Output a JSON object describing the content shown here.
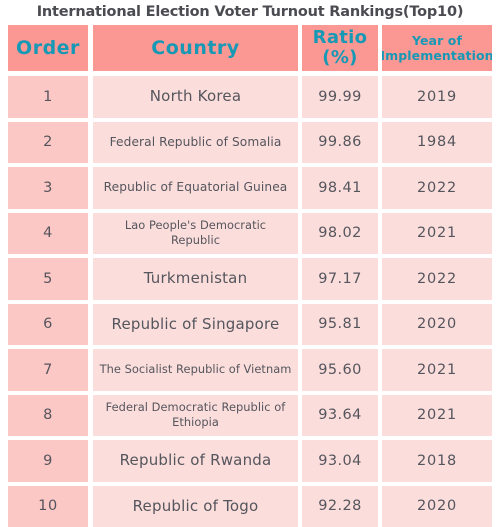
{
  "title": "International Election Voter Turnout Rankings(Top10)",
  "colors": {
    "header_bg": "#FB9894",
    "header_text": "#1799B5",
    "order_cell_bg": "#FCC8C6",
    "cell_bg": "#FBDEDC",
    "body_text": "#55555D",
    "title_text": "#4B4B52",
    "page_bg": "#FFFFFF"
  },
  "columns": [
    {
      "key": "order",
      "label": "Order"
    },
    {
      "key": "country",
      "label": "Country"
    },
    {
      "key": "ratio",
      "label": "Ratio\n(%)",
      "label_line1": "Ratio",
      "label_line2": "(%)"
    },
    {
      "key": "year",
      "label": "Year of Implementation",
      "label_line1": "Year of",
      "label_line2": "Implementation"
    }
  ],
  "rows": [
    {
      "order": "1",
      "country": "North Korea",
      "ratio": "99.99",
      "year": "2019",
      "size": "lg"
    },
    {
      "order": "2",
      "country": "Federal Republic of Somalia",
      "ratio": "99.86",
      "year": "1984",
      "size": "md"
    },
    {
      "order": "3",
      "country": "Republic of Equatorial Guinea",
      "ratio": "98.41",
      "year": "2022",
      "size": "md"
    },
    {
      "order": "4",
      "country": "Lao People's Democratic Republic",
      "ratio": "98.02",
      "year": "2021",
      "size": "sm"
    },
    {
      "order": "5",
      "country": "Turkmenistan",
      "ratio": "97.17",
      "year": "2022",
      "size": "lg"
    },
    {
      "order": "6",
      "country": "Republic of Singapore",
      "ratio": "95.81",
      "year": "2020",
      "size": "lg"
    },
    {
      "order": "7",
      "country": "The Socialist Republic of Vietnam",
      "ratio": "95.60",
      "year": "2021",
      "size": "sm"
    },
    {
      "order": "8",
      "country": "Federal Democratic Republic of Ethiopia",
      "ratio": "93.64",
      "year": "2021",
      "size": "sm"
    },
    {
      "order": "9",
      "country": "Republic of Rwanda",
      "ratio": "93.04",
      "year": "2018",
      "size": "lg"
    },
    {
      "order": "10",
      "country": "Republic of Togo",
      "ratio": "92.28",
      "year": "2020",
      "size": "lg"
    }
  ],
  "chart_data": {
    "type": "table",
    "title": "International Election Voter Turnout Rankings(Top10)",
    "columns": [
      "Order",
      "Country",
      "Ratio (%)",
      "Year of Implementation"
    ],
    "categories": [
      "North Korea",
      "Federal Republic of Somalia",
      "Republic of Equatorial Guinea",
      "Lao People's Democratic Republic",
      "Turkmenistan",
      "Republic of Singapore",
      "The Socialist Republic of Vietnam",
      "Federal Democratic Republic of Ethiopia",
      "Republic of Rwanda",
      "Republic of Togo"
    ],
    "values": [
      99.99,
      99.86,
      98.41,
      98.02,
      97.17,
      95.81,
      95.6,
      93.64,
      93.04,
      92.28
    ],
    "series": [
      {
        "name": "Ratio (%)",
        "values": [
          99.99,
          99.86,
          98.41,
          98.02,
          97.17,
          95.81,
          95.6,
          93.64,
          93.04,
          92.28
        ]
      },
      {
        "name": "Year of Implementation",
        "values": [
          2019,
          1984,
          2022,
          2021,
          2022,
          2020,
          2021,
          2021,
          2018,
          2020
        ]
      },
      {
        "name": "Order",
        "values": [
          1,
          2,
          3,
          4,
          5,
          6,
          7,
          8,
          9,
          10
        ]
      }
    ],
    "xlabel": "Country",
    "ylabel": "Ratio (%)",
    "grid": false,
    "legend": "none"
  }
}
